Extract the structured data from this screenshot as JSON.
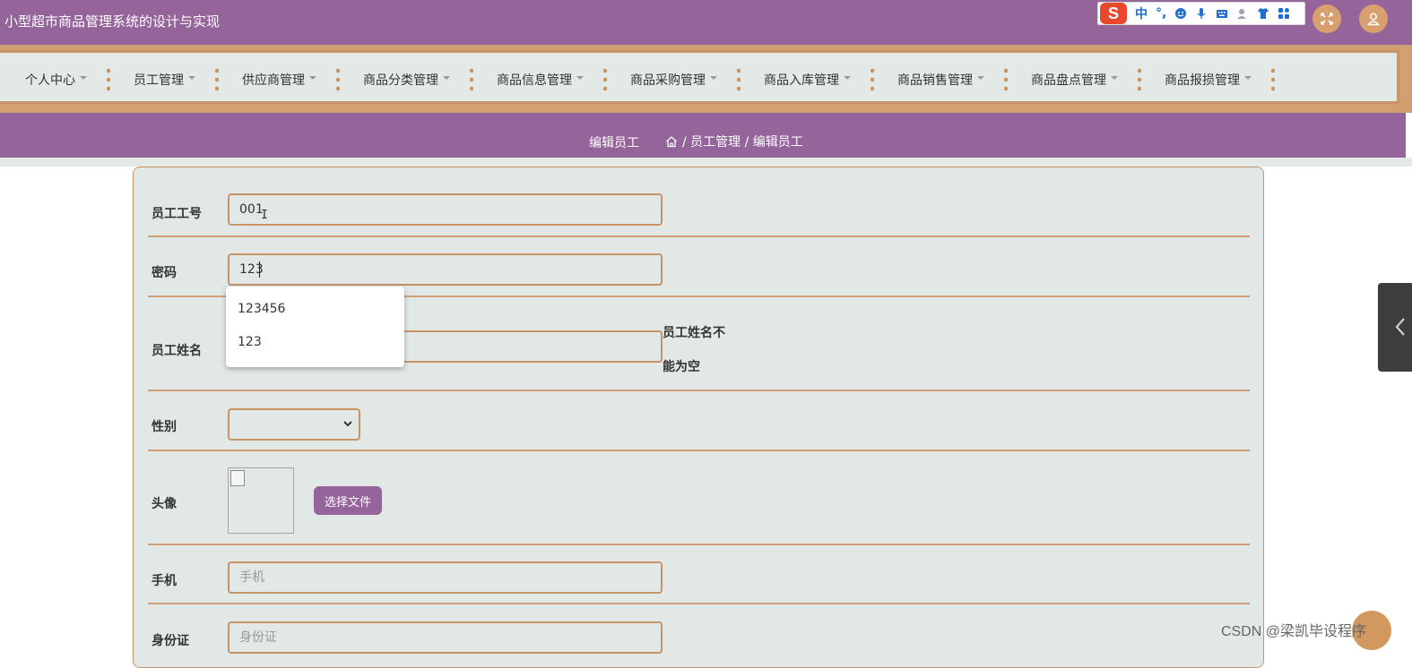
{
  "header": {
    "title": "小型超市商品管理系统的设计与实现",
    "ime": {
      "logo": "S",
      "mode": "中",
      "punct": "°,"
    }
  },
  "nav": {
    "items": [
      {
        "label": "个人中心"
      },
      {
        "label": "员工管理"
      },
      {
        "label": "供应商管理"
      },
      {
        "label": "商品分类管理"
      },
      {
        "label": "商品信息管理"
      },
      {
        "label": "商品采购管理"
      },
      {
        "label": "商品入库管理"
      },
      {
        "label": "商品销售管理"
      },
      {
        "label": "商品盘点管理"
      },
      {
        "label": "商品报损管理"
      }
    ]
  },
  "breadcrumb": {
    "title": "编辑员工",
    "path": "/ 员工管理 / 编辑员工"
  },
  "form": {
    "employee_id": {
      "label": "员工工号",
      "value": "001"
    },
    "password": {
      "label": "密码",
      "value": "123"
    },
    "name": {
      "label": "员工姓名",
      "value": "",
      "error_line1": "员工姓名不",
      "error_line2": "能为空"
    },
    "gender": {
      "label": "性别",
      "value": ""
    },
    "avatar": {
      "label": "头像",
      "button": "选择文件"
    },
    "phone": {
      "label": "手机",
      "placeholder": "手机"
    },
    "id_card": {
      "label": "身份证",
      "placeholder": "身份证"
    }
  },
  "autocomplete": {
    "options": [
      "123456",
      "123"
    ]
  },
  "watermark": "CSDN @梁凯毕设程序",
  "colors": {
    "primary": "#94649b",
    "accent": "#c9936a",
    "panel": "#e1e8e5"
  }
}
